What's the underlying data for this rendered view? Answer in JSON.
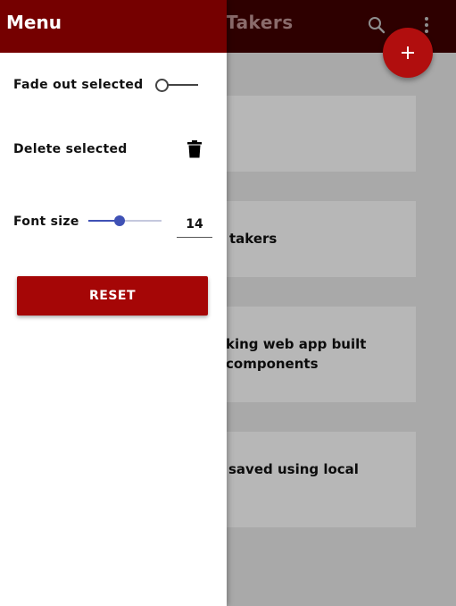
{
  "appbar": {
    "title": "Takers",
    "icons": [
      "search-icon",
      "more-vert-icon"
    ]
  },
  "fab": {
    "icon": "plus-icon",
    "color": "#b10e0e"
  },
  "notes": [
    {
      "text_lines": [
        ""
      ]
    },
    {
      "text_lines": [
        "takers"
      ]
    },
    {
      "text_lines": [
        "king web app built",
        "components"
      ]
    },
    {
      "text_lines": [
        "saved using local"
      ]
    }
  ],
  "drawer": {
    "title": "Menu",
    "header_color": "#750000",
    "fade_out_label": "Fade out selected",
    "fade_out_enabled": false,
    "delete_label": "Delete selected",
    "font_size_label": "Font size",
    "font_size_value": "14",
    "font_size_slider_fraction": 0.43,
    "reset_label": "RESET",
    "reset_color": "#a50606",
    "accent": "#3f51b5"
  }
}
